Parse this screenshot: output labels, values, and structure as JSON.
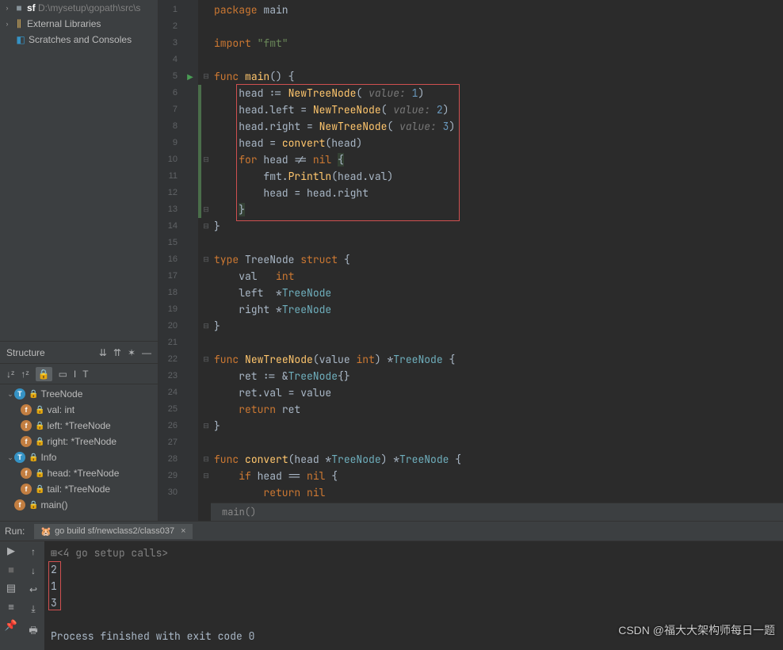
{
  "project": {
    "root_label": "sf",
    "root_path": "D:\\mysetup\\gopath\\src\\s",
    "libs": "External Libraries",
    "scratches": "Scratches and Consoles"
  },
  "structure": {
    "title": "Structure",
    "tree": [
      {
        "kind": "T",
        "name": "TreeNode",
        "indent": 0
      },
      {
        "kind": "f",
        "name": "val: int",
        "indent": 1
      },
      {
        "kind": "f",
        "name": "left: *TreeNode",
        "indent": 1
      },
      {
        "kind": "f",
        "name": "right: *TreeNode",
        "indent": 1
      },
      {
        "kind": "T",
        "name": "Info",
        "indent": 0
      },
      {
        "kind": "f",
        "name": "head: *TreeNode",
        "indent": 1
      },
      {
        "kind": "f",
        "name": "tail: *TreeNode",
        "indent": 1
      },
      {
        "kind": "f",
        "name": "main()",
        "indent": 0
      }
    ]
  },
  "editor": {
    "breadcrumb": "main()",
    "line_count": 30
  },
  "run": {
    "label": "Run:",
    "tab": "go build sf/newclass2/class037",
    "setup": "<4 go setup calls>",
    "output": [
      "2",
      "1",
      "3"
    ],
    "exit": "Process finished with exit code 0"
  },
  "watermark": "CSDN @福大大架构师每日一题"
}
